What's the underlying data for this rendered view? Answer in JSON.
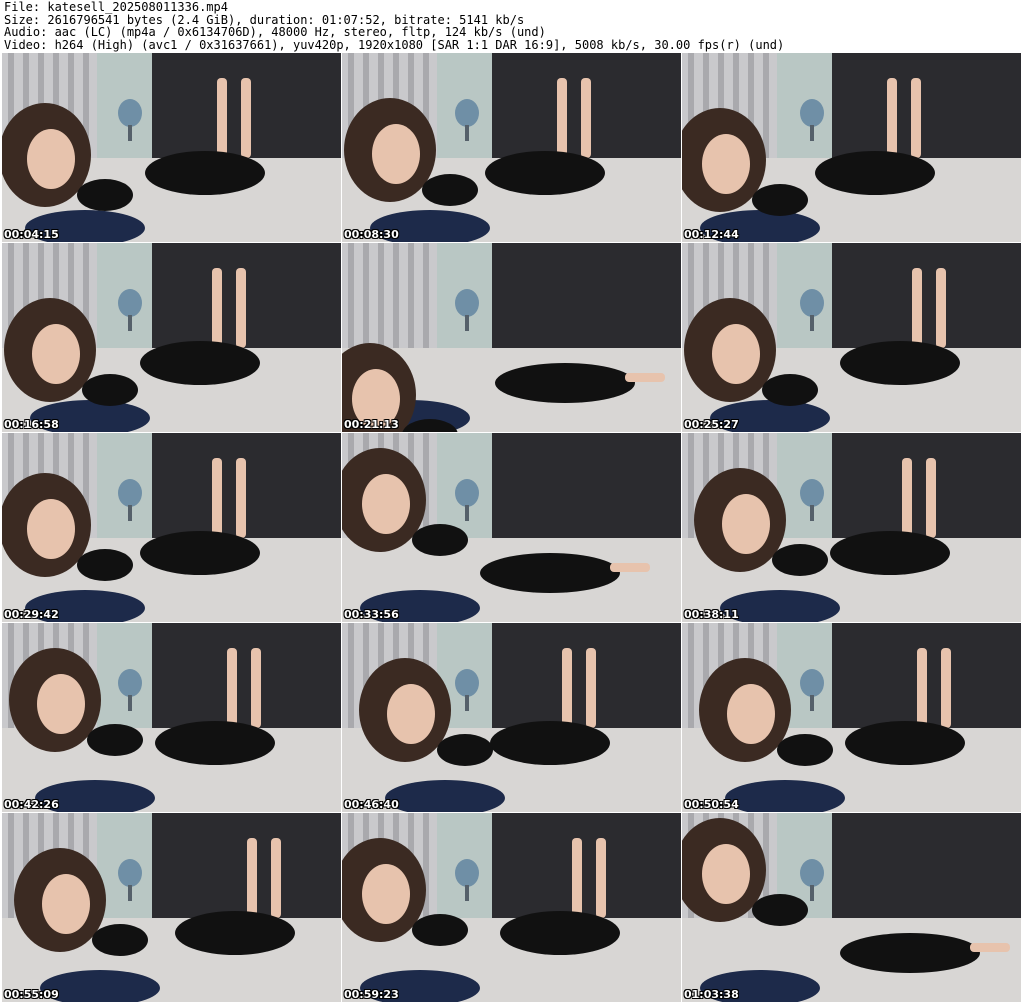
{
  "header": {
    "file_line": "File: katesell_202508011336.mp4",
    "size_line": "Size: 2616796541 bytes (2.4 GiB), duration: 01:07:52, bitrate: 5141 kb/s",
    "audio_line": "Audio: aac (LC) (mp4a / 0x6134706D), 48000 Hz, stereo, fltp, 124 kb/s (und)",
    "video_line": "Video: h264 (High) (avc1 / 0x31637661), yuv420p, 1920x1080 [SAR 1:1 DAR 16:9], 5008 kb/s, 30.00 fps(r) (und)"
  },
  "thumbnails": [
    {
      "timestamp": "00:04:15"
    },
    {
      "timestamp": "00:08:30"
    },
    {
      "timestamp": "00:12:44"
    },
    {
      "timestamp": "00:16:58"
    },
    {
      "timestamp": "00:21:13"
    },
    {
      "timestamp": "00:25:27"
    },
    {
      "timestamp": "00:29:42"
    },
    {
      "timestamp": "00:33:56"
    },
    {
      "timestamp": "00:38:11"
    },
    {
      "timestamp": "00:42:26"
    },
    {
      "timestamp": "00:46:40"
    },
    {
      "timestamp": "00:50:54"
    },
    {
      "timestamp": "00:55:09"
    },
    {
      "timestamp": "00:59:23"
    },
    {
      "timestamp": "01:03:38"
    }
  ],
  "colors": {
    "background": "#ffffff",
    "header_text": "#000000",
    "timestamp_text": "#ffffff",
    "curtain": "#2b2b2f",
    "wall": "#b9c7c4",
    "headboard": "#c9c9cc",
    "bedding": "#d8d6d4",
    "pillow": "#1d2a4a",
    "clothing": "#111111",
    "skin": "#e7c3ad",
    "hair": "#3b2a22",
    "lamp": "#6f8fa6"
  }
}
